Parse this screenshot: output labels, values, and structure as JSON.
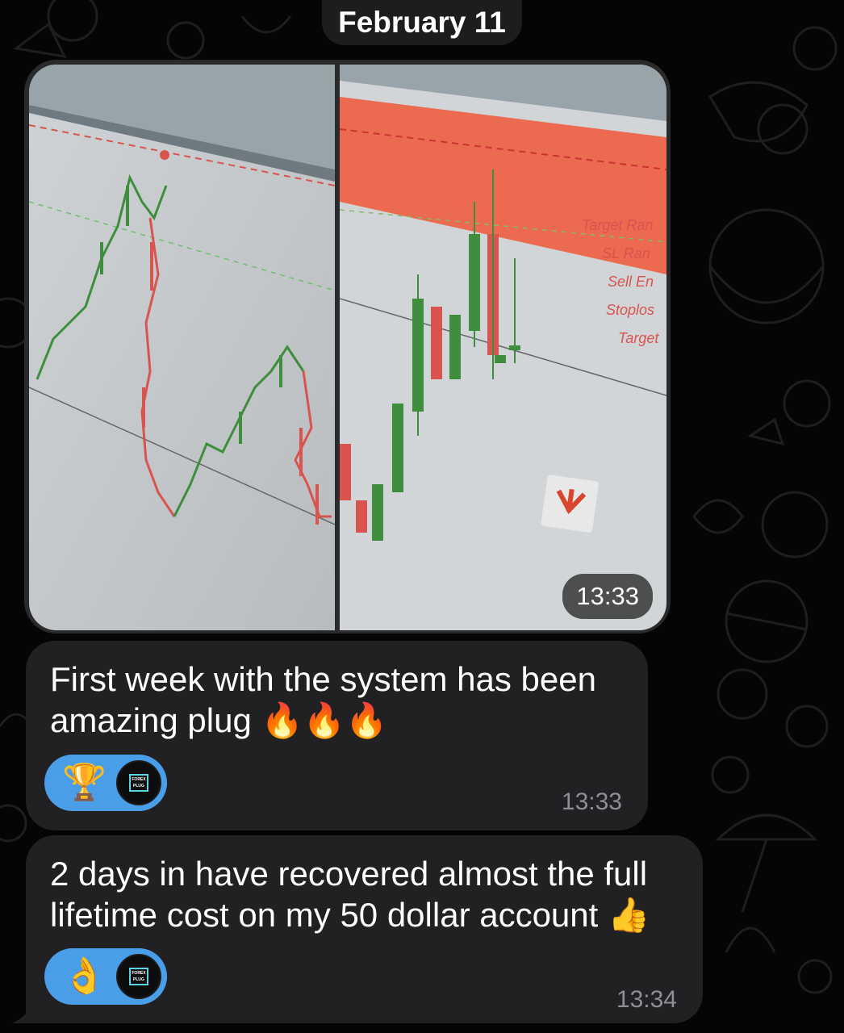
{
  "date_header": "February 11",
  "album": {
    "time": "13:33",
    "photo_left": {
      "description_icon": "chart-photo-icon"
    },
    "photo_right": {
      "labels": [
        "Target Ran",
        "SL Ran",
        "Sell En",
        "Stoplos",
        "Target"
      ]
    }
  },
  "messages": [
    {
      "text": "First week with the system has been amazing plug",
      "emoji": "🔥🔥🔥",
      "reaction": {
        "emoji": "🏆",
        "avatar_label": "FOREX PLUG"
      },
      "time": "13:33"
    },
    {
      "text": "2 days in have recovered almost the full lifetime cost on my 50 dollar account",
      "emoji": "👍",
      "reaction": {
        "emoji": "👌",
        "avatar_label": "FOREX PLUG"
      },
      "time": "13:34"
    }
  ],
  "colors": {
    "background": "#050505",
    "bubble": "#212124",
    "reaction": "#4a9ee8",
    "time": "#8e8e93"
  }
}
